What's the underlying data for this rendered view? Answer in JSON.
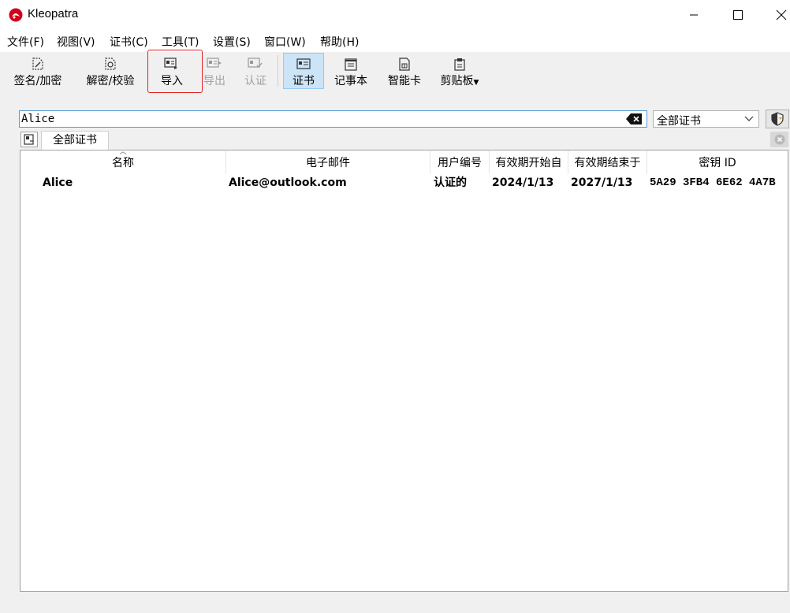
{
  "window": {
    "title": "Kleopatra"
  },
  "menu": [
    "文件(F)",
    "视图(V)",
    "证书(C)",
    "工具(T)",
    "设置(S)",
    "窗口(W)",
    "帮助(H)"
  ],
  "toolbar": {
    "sign_encrypt": "签名/加密",
    "decrypt_verify": "解密/校验",
    "import": "导入",
    "export": "导出",
    "certify": "认证",
    "certificates": "证书",
    "notepad": "记事本",
    "smartcard": "智能卡",
    "clipboard": "剪贴板"
  },
  "search": {
    "value": "Alice"
  },
  "filter": {
    "selected": "全部证书"
  },
  "tab": {
    "label": "全部证书"
  },
  "table": {
    "headers": {
      "name": "名称",
      "email": "电子邮件",
      "user_id": "用户编号",
      "valid_from": "有效期开始自",
      "valid_until": "有效期结束于",
      "key_id": "密钥 ID"
    },
    "rows": [
      {
        "name": "Alice",
        "email": "Alice@outlook.com",
        "user_id": "认证的",
        "valid_from": "2024/1/13",
        "valid_until": "2027/1/13",
        "key_id": "5A29 3FB4 6E62 4A7B"
      }
    ]
  },
  "colors": {
    "highlight": "#e02020",
    "active_button": "#cce4f7",
    "search_border": "#5b9bd5"
  }
}
